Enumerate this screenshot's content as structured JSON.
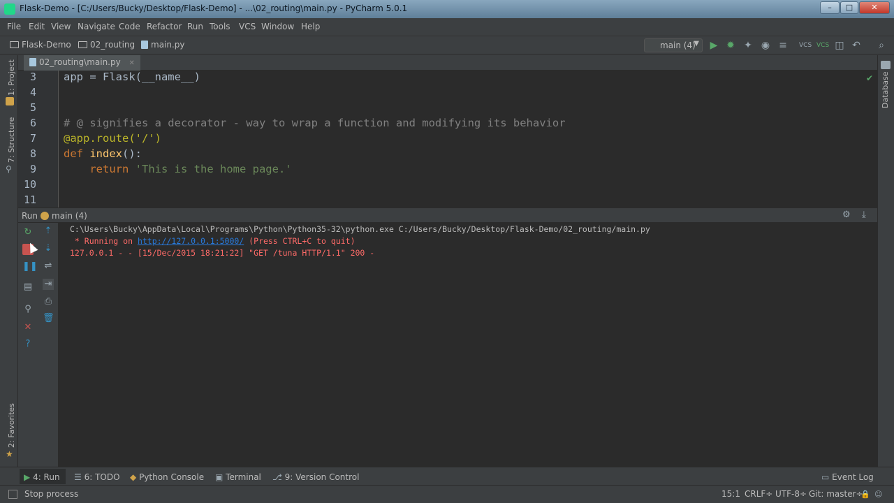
{
  "window": {
    "title": "Flask-Demo - [C:/Users/Bucky/Desktop/Flask-Demo] - ...\\02_routing\\main.py - PyCharm 5.0.1"
  },
  "menu": [
    "File",
    "Edit",
    "View",
    "Navigate",
    "Code",
    "Refactor",
    "Run",
    "Tools",
    "VCS",
    "Window",
    "Help"
  ],
  "breadcrumbs": [
    "Flask-Demo",
    "02_routing",
    "main.py"
  ],
  "run_config": "main (4)",
  "left_strip": {
    "project": "1: Project",
    "structure": "7: Structure",
    "favorites": "2: Favorites"
  },
  "right_strip": {
    "database": "Database"
  },
  "editor": {
    "tab": "02_routing\\main.py",
    "line_numbers": [
      "3",
      "4",
      "5",
      "6",
      "7",
      "8",
      "9",
      "10",
      "11"
    ],
    "lines": {
      "l3": "app = Flask(__name__)",
      "l6": "# @ signifies a decorator - way to wrap a function and modifying its behavior",
      "l7": "@app.route('/')",
      "l8_kw": "def",
      "l8_fn": "index",
      "l8_rest": "():",
      "l9_kw": "return",
      "l9_str": "'This is the home page.'"
    }
  },
  "run_panel": {
    "label": "Run",
    "config": "main (4)",
    "console": {
      "cmd": "C:\\Users\\Bucky\\AppData\\Local\\Programs\\Python\\Python35-32\\python.exe C:/Users/Bucky/Desktop/Flask-Demo/02_routing/main.py",
      "running_prefix": " * Running on ",
      "running_link": "http://127.0.0.1:5000/",
      "running_suffix": " (Press CTRL+C to quit)",
      "request": "127.0.0.1 - - [15/Dec/2015 18:21:22] \"GET /tuna HTTP/1.1\" 200 -"
    }
  },
  "bottom_tools": {
    "run": "4: Run",
    "todo": "6: TODO",
    "python_console": "Python Console",
    "terminal": "Terminal",
    "version_control": "9: Version Control",
    "event_log": "Event Log"
  },
  "status": {
    "message": "Stop process",
    "position": "15:1",
    "line_sep": "CRLF÷",
    "encoding": "UTF-8÷",
    "git": "Git: master÷"
  },
  "colors": {
    "editor_bg": "#2b2b2b",
    "panel_bg": "#3c3f41",
    "keyword": "#cc7832",
    "string": "#6a8759",
    "comment": "#808080",
    "error_text": "#ff6b68",
    "link": "#287bde"
  }
}
